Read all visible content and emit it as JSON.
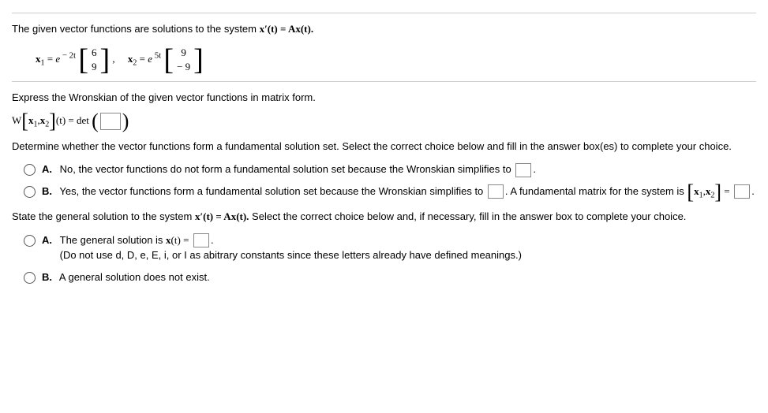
{
  "intro": "The given vector functions are solutions to the system ",
  "introEq": "x′(t) = Ax(t).",
  "eq": {
    "x1": {
      "lhs_var": "x",
      "lhs_sub": "1",
      "eq": " = ",
      "e": "e",
      "exp": " − 2t",
      "top": "6",
      "bot": "9"
    },
    "x2": {
      "lhs_var": "x",
      "lhs_sub": "2",
      "eq": " = ",
      "e": "e",
      "exp": " 5t",
      "top": "9",
      "bot": "− 9"
    }
  },
  "prompt1": "Express the Wronskian of the given vector functions in matrix form.",
  "wron": {
    "lhs": "W",
    "br_open": "[",
    "x1": "x",
    "s1": "1",
    "comma": ",",
    "x2": "x",
    "s2": "2",
    "br_close": "]",
    "t": "(t) = det",
    "paren_open": "(",
    "paren_close": ")"
  },
  "prompt2": "Determine whether the vector functions form a fundamental solution set. Select the correct choice below and fill in the answer box(es) to complete your choice.",
  "q1": {
    "a_label": "A.",
    "a_text": "No, the vector functions do not form a fundamental solution set because the Wronskian simplifies to",
    "a_end": ".",
    "b_label": "B.",
    "b_text": "Yes, the vector functions form a fundamental solution set because the Wronskian simplifies to",
    "b_mid": ". A fundamental matrix for the system is ",
    "b_math_open": "[",
    "b_math_x1": "x",
    "b_math_s1": "1",
    "b_math_c": ",",
    "b_math_x2": "x",
    "b_math_s2": "2",
    "b_math_close": "]",
    "b_math_eq": " =",
    "b_end": "."
  },
  "prompt3": "State the general solution to the system ",
  "prompt3eq": "x′(t) = Ax(t).",
  "prompt3b": " Select the correct choice below and, if necessary, fill in the answer box to complete your choice.",
  "q2": {
    "a_label": "A.",
    "a_text": "The general solution is ",
    "a_math": "x",
    "a_math2": "(t) =",
    "a_end": ".",
    "a_note": "(Do not use d, D, e, E, i, or I as abitrary constants since these letters already have defined meanings.)",
    "b_label": "B.",
    "b_text": "A general solution does not exist."
  }
}
